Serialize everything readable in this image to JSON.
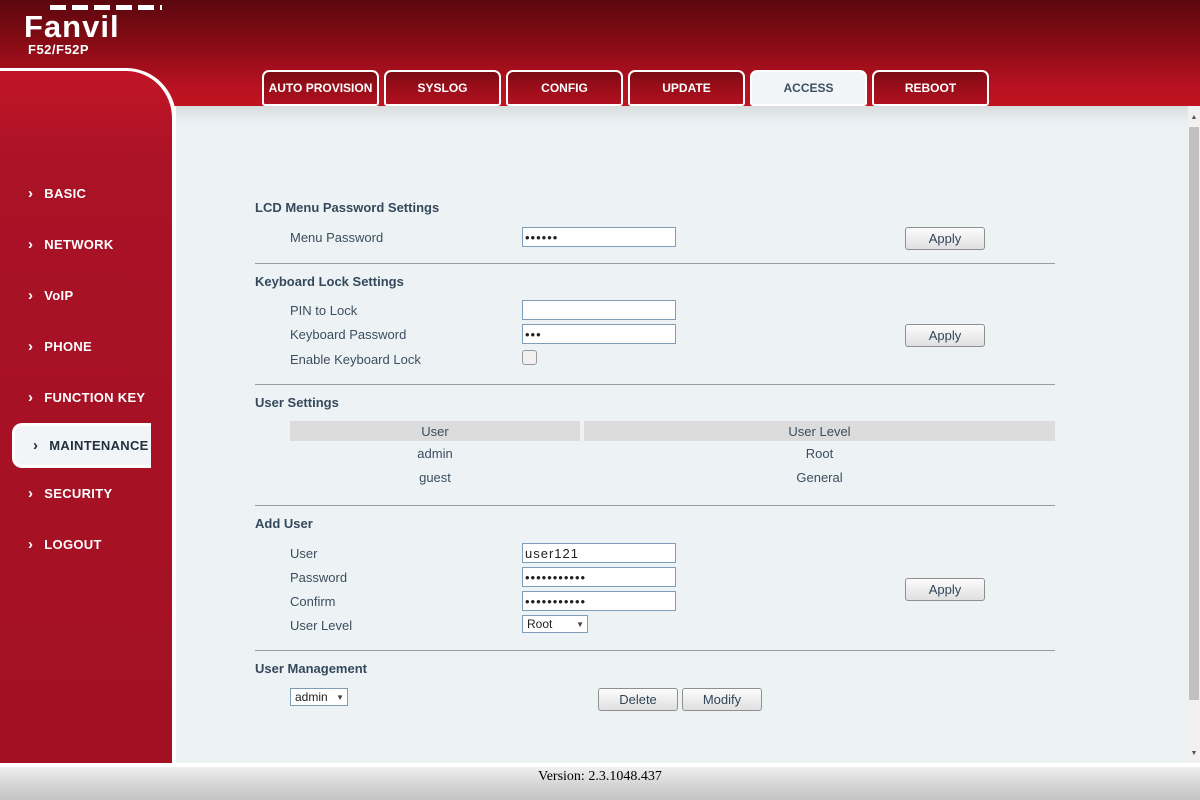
{
  "brand": {
    "logo": "Fanvil",
    "model": "F52/F52P"
  },
  "tabs": [
    {
      "label": "AUTO PROVISION",
      "active": false
    },
    {
      "label": "SYSLOG",
      "active": false
    },
    {
      "label": "CONFIG",
      "active": false
    },
    {
      "label": "UPDATE",
      "active": false
    },
    {
      "label": "ACCESS",
      "active": true
    },
    {
      "label": "REBOOT",
      "active": false
    }
  ],
  "sidebar": {
    "items": [
      {
        "label": "BASIC",
        "active": false
      },
      {
        "label": "NETWORK",
        "active": false
      },
      {
        "label": "VoIP",
        "active": false
      },
      {
        "label": "PHONE",
        "active": false
      },
      {
        "label": "FUNCTION KEY",
        "active": false
      },
      {
        "label": "MAINTENANCE",
        "active": true
      },
      {
        "label": "SECURITY",
        "active": false
      },
      {
        "label": "LOGOUT",
        "active": false
      }
    ]
  },
  "sections": {
    "lcd_menu_password": {
      "title": "LCD Menu Password Settings",
      "menu_password_label": "Menu Password",
      "menu_password_value": "••••••",
      "apply_label": "Apply"
    },
    "keyboard_lock": {
      "title": "Keyboard Lock Settings",
      "pin_label": "PIN to Lock",
      "pin_value": "",
      "keyboard_password_label": "Keyboard Password",
      "keyboard_password_value": "•••",
      "enable_label": "Enable Keyboard Lock",
      "enable_checked": false,
      "apply_label": "Apply"
    },
    "user_settings": {
      "title": "User Settings",
      "columns": [
        "User",
        "User Level"
      ],
      "rows": [
        [
          "admin",
          "Root"
        ],
        [
          "guest",
          "General"
        ]
      ]
    },
    "add_user": {
      "title": "Add User",
      "user_label": "User",
      "user_value": "user121",
      "password_label": "Password",
      "password_value": "•••••••••••",
      "confirm_label": "Confirm",
      "confirm_value": "•••••••••••",
      "user_level_label": "User Level",
      "user_level_value": "Root",
      "apply_label": "Apply"
    },
    "user_management": {
      "title": "User Management",
      "selected_user": "admin",
      "delete_label": "Delete",
      "modify_label": "Modify"
    }
  },
  "footer": {
    "version": "Version: 2.3.1048.437"
  },
  "icons": {
    "sidebar_chevron": "›",
    "dropdown_arrow": "▼",
    "scroll_up_arrow": "▲",
    "scroll_down_arrow": "▼"
  },
  "colors": {
    "brand_red": "#a81124",
    "header_red_dark": "#5a070d",
    "header_red_bright": "#c2131f",
    "heading_text": "#35495c",
    "input_border": "#7f9db9",
    "table_header_bg": "#dcdcdc"
  }
}
